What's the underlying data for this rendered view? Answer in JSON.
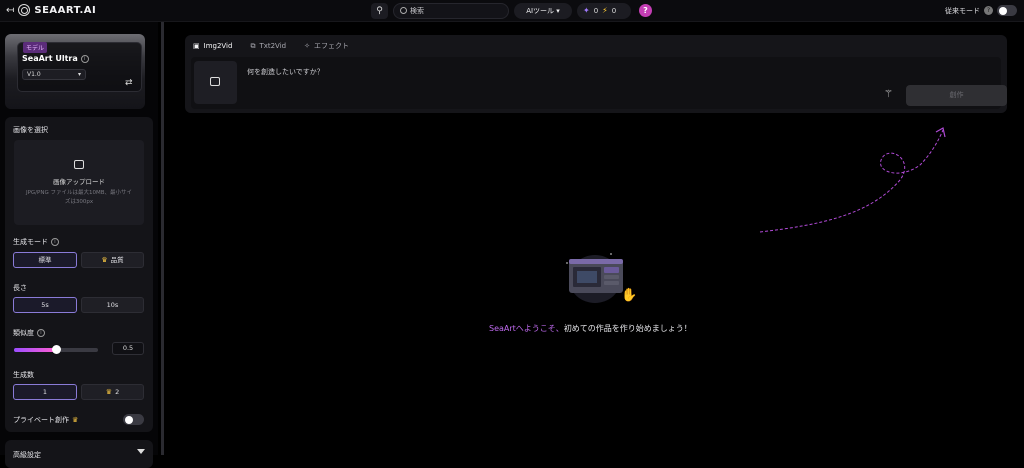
{
  "header": {
    "brand": "SEAART.AI",
    "search_placeholder": "検索",
    "ai_tools": "AIツール",
    "gem_count": "0",
    "bolt_count": "0",
    "help": "?",
    "legacy_mode": "従来モード"
  },
  "model": {
    "tag": "モデル",
    "name": "SeaArt Ultra",
    "version": "V1.0"
  },
  "panel": {
    "select_image": "画像を選択",
    "upload_title": "画像アップロード",
    "upload_hint": "JPG/PNG ファイルは最大10MB、最小サイズは300px",
    "gen_mode_label": "生成モード",
    "mode_standard": "標準",
    "mode_quality": "品質",
    "length_label": "長さ",
    "length_5s": "5s",
    "length_10s": "10s",
    "similarity_label": "類似度",
    "similarity_value": "0.5",
    "similarity_fraction": 0.5,
    "count_label": "生成数",
    "count_1": "1",
    "count_2": "2",
    "private_label": "プライベート創作",
    "advanced": "高級設定"
  },
  "workspace": {
    "tabs": [
      {
        "label": "Img2Vid",
        "icon": "video-icon"
      },
      {
        "label": "Txt2Vid",
        "icon": "text-video-icon"
      },
      {
        "label": "エフェクト",
        "icon": "sparkle-icon"
      }
    ],
    "prompt_placeholder": "何を創造したいですか？",
    "create": "創作"
  },
  "empty_state": {
    "brand_part": "SeaArtへようこそ、",
    "rest": "初めての作品を作り始めましょう！"
  },
  "colors": {
    "accent": "#c06bf0",
    "help_bg": "#c43eb4",
    "active_border": "#8a7bd8"
  }
}
